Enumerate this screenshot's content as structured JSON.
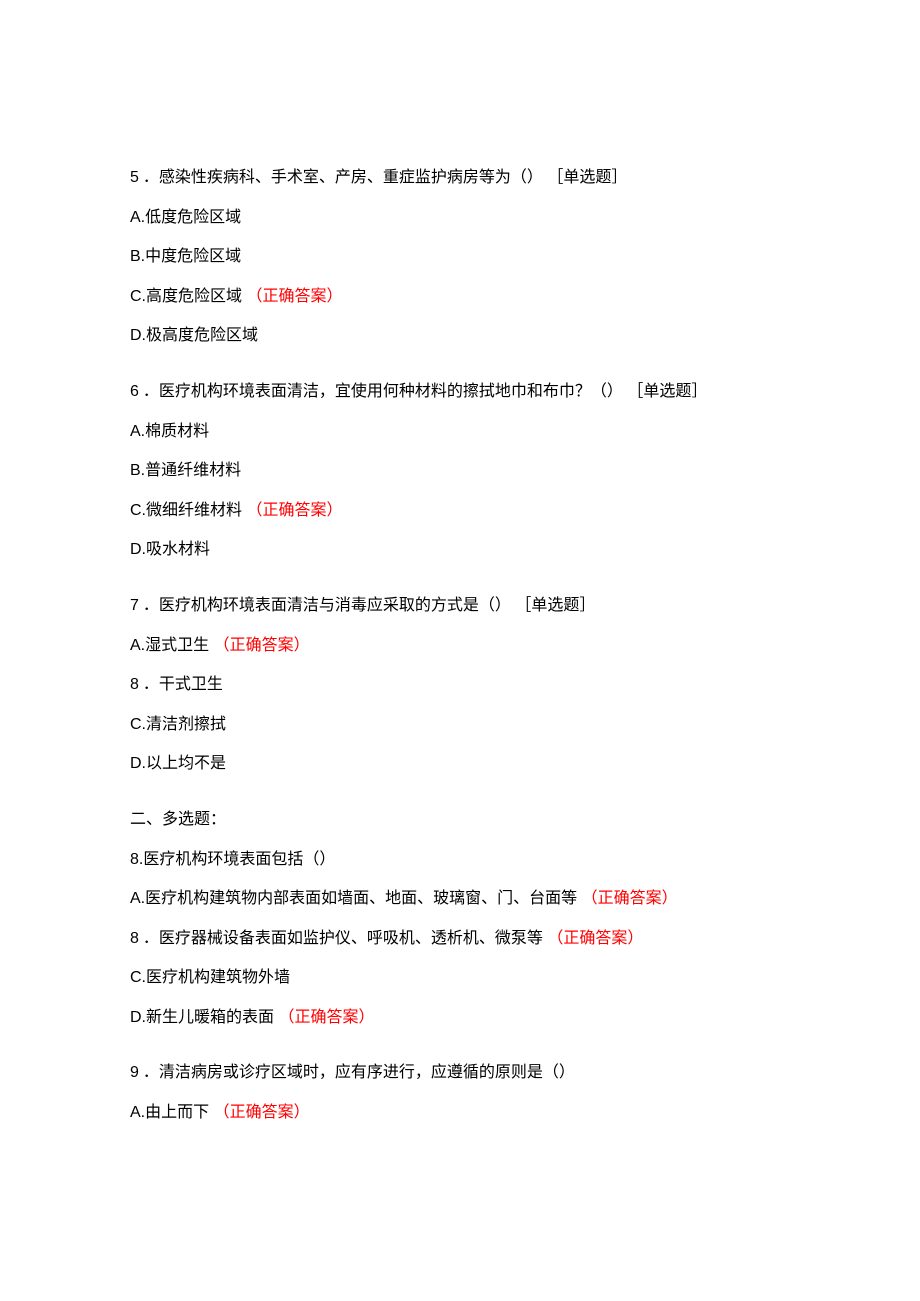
{
  "correct_label": "（正确答案）",
  "section2_header": "二、多选题：",
  "q5": {
    "num": "5",
    "text": "．感染性疾病科、手术室、产房、重症监护病房等为（） ［单选题］",
    "optA": "A.低度危险区域",
    "optB": "B.中度危险区域",
    "optC": "C.高度危险区域",
    "optD": "D.极高度危险区域"
  },
  "q6": {
    "num": "6",
    "text": "．医疗机构环境表面清洁，宜使用何种材料的擦拭地巾和布巾？（） ［单选题］",
    "optA": "A.棉质材料",
    "optB": "B.普通纤维材料",
    "optC": "C.微细纤维材料",
    "optD": "D.吸水材料"
  },
  "q7": {
    "num": "7",
    "text": "．医疗机构环境表面清洁与消毒应采取的方式是（） ［单选题］",
    "optA": "A.湿式卫生",
    "optB_num": "8",
    "optB_text": "．干式卫生",
    "optC": "C.清洁剂擦拭",
    "optD": "D.以上均不是"
  },
  "q8": {
    "text": "8.医疗机构环境表面包括（）",
    "optA": "A.医疗机构建筑物内部表面如墙面、地面、玻璃窗、门、台面等",
    "optB_num": "8",
    "optB_text": "．医疗器械设备表面如监护仪、呼吸机、透析机、微泵等",
    "optC": "C.医疗机构建筑物外墙",
    "optD": "D.新生儿暖箱的表面"
  },
  "q9": {
    "num": "9",
    "text": "．清洁病房或诊疗区域时，应有序进行，应遵循的原则是（）",
    "optA": "A.由上而下"
  }
}
